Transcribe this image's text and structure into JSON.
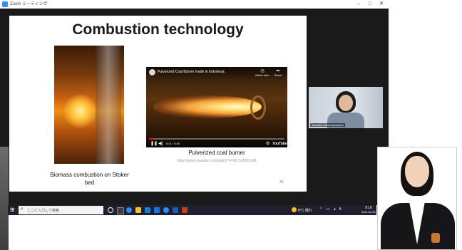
{
  "window": {
    "title": "Zoom ミーティング"
  },
  "slide": {
    "title": "Combustion technology",
    "left_image_caption": "Biomass combustion on Stoker bed",
    "video": {
      "title": "Pulverized Coal Burner made in Indonesia",
      "watch_later": "Watch later",
      "share": "Share",
      "time": "0:01 / 0:30",
      "progress": 0.03,
      "logo": "YouTube"
    },
    "right_caption": "Pulverized coal burner",
    "video_url": "https://www.youtube.com/watch?v=9fL7uW2DvM8",
    "page_number": "22"
  },
  "participant": {
    "name": "Jesadari Sukhanpimpisut"
  },
  "taskbar": {
    "search_placeholder": "ここに入力して検索",
    "weather": "8°C 晴れ",
    "clock_time": "9:16",
    "clock_date": "2021/12/21"
  },
  "colors": {
    "zoom_bg": "#1a1a1a",
    "taskbar_bg": "#1f1f2e",
    "youtube_red": "#ff0000"
  }
}
